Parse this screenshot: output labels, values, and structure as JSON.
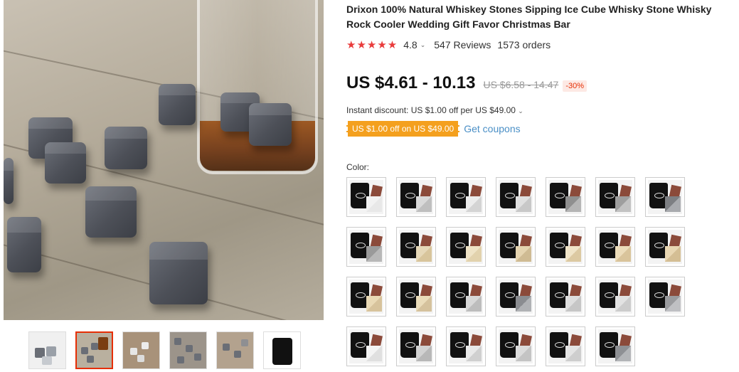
{
  "product": {
    "title": "Drixon 100% Natural Whiskey Stones Sipping Ice Cube Whisky Stone Whisky Rock Cooler Wedding Gift Favor Christmas Bar",
    "stars": "★★★★★",
    "rating": "4.8",
    "reviews": "547 Reviews",
    "orders": "1573 orders"
  },
  "pricing": {
    "price": "US $4.61 - 10.13",
    "original_price": "US $6.58 - 14.47",
    "discount": "-30%",
    "instant_discount": "Instant discount: US $1.00 off per US $49.00",
    "coupon": "US $1.00 off on US $49.00",
    "get_coupons": "Get coupons"
  },
  "variants": {
    "label": "Color:",
    "count": 27
  },
  "colors": {
    "accent_red": "#e62e04",
    "star_red": "#e93b3b",
    "coupon_orange": "#f4a01e",
    "link_blue": "#4a8fc6"
  },
  "gallery": {
    "thumbnail_count": 6,
    "active_index": 1
  }
}
